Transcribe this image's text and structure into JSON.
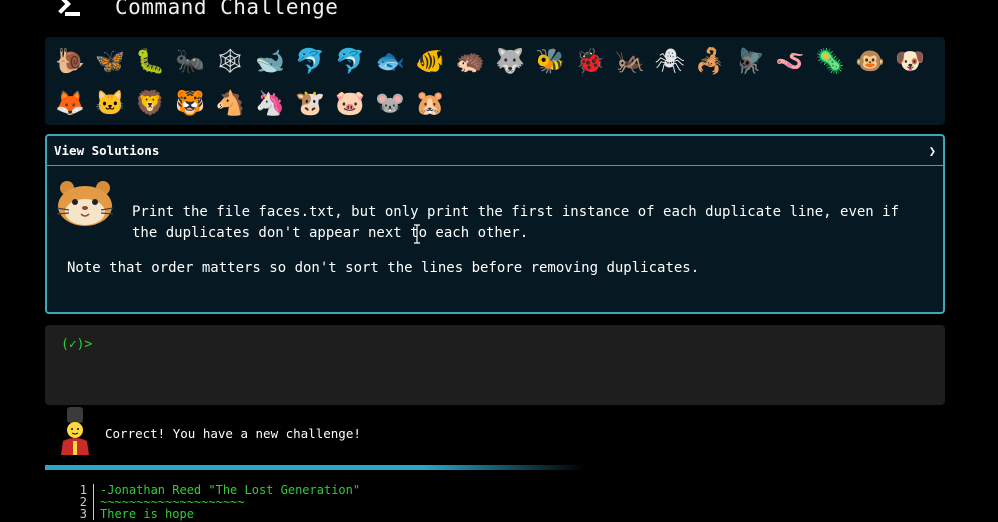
{
  "header": {
    "title": "Command Challenge",
    "icon": "terminal-icon"
  },
  "animals": {
    "row1": [
      "🐌",
      "🦋",
      "🐛",
      "🐜",
      "🕸",
      "🐋",
      "🐬",
      "🐬",
      "🐟",
      "🐠",
      "🦔",
      "🐺",
      "🐝",
      "🐞",
      "🦗",
      "🕷",
      "🦂",
      "🪰",
      "🪱",
      "🦠",
      "🐵",
      "🐶"
    ],
    "row2": [
      "🦊",
      "🐱",
      "🦁",
      "🐯",
      "🐴",
      "🦄",
      "🐮",
      "🐷",
      "🐭",
      "🐹"
    ]
  },
  "challenge_panel": {
    "header_label": "View Solutions",
    "expand_glyph": "❯",
    "task": "Print the file faces.txt, but only print the first instance of each duplicate line, even if the duplicates don't appear next to each other.",
    "note": "Note that order matters so don't sort the lines before removing duplicates.",
    "avatar": "hamster-icon"
  },
  "terminal": {
    "prompt": "(✓)>"
  },
  "feedback": {
    "message": "Correct! You have a new challenge!",
    "avatar": "guard-icon"
  },
  "progress": {
    "fraction": 0.6,
    "color": "#2aa6c9"
  },
  "file_view": {
    "lines": [
      {
        "n": "1",
        "text": "-Jonathan Reed \"The Lost Generation\""
      },
      {
        "n": "2",
        "text": "~~~~~~~~~~~~~~~~~~~~"
      },
      {
        "n": "3",
        "text": "There is hope"
      }
    ]
  },
  "colors": {
    "accent": "#3aa7ba",
    "prompt_green": "#33cc33",
    "panel_bg": "#061922"
  }
}
